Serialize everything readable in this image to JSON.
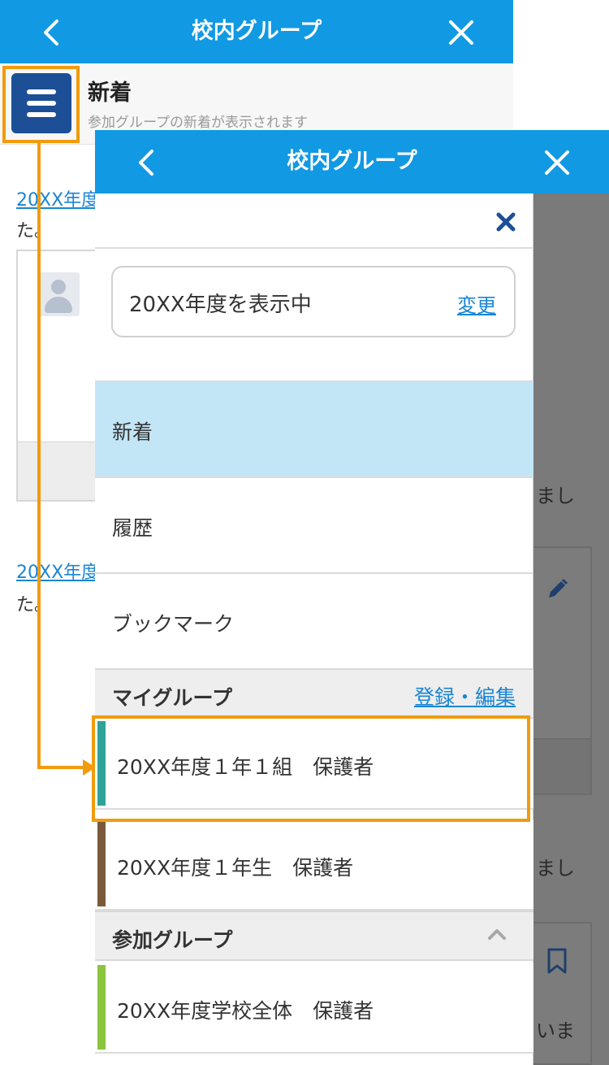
{
  "header": {
    "title": "校内グループ"
  },
  "subheader": {
    "title": "新着",
    "subtitle": "参加グループの新着が表示されます"
  },
  "background": {
    "link1": "20XX年度",
    "text1": "た。",
    "link2": "20XX年度",
    "text2": "た。",
    "side_text_1": "まし",
    "side_text_2": "まし",
    "side_text_3": "いま"
  },
  "drawer": {
    "title": "校内グループ",
    "year_label": "20XX年度を表示中",
    "change_label": "変更",
    "nav_items": [
      {
        "label": "新着",
        "active": true
      },
      {
        "label": "履歴",
        "active": false
      },
      {
        "label": "ブックマーク",
        "active": false
      }
    ],
    "my_groups": {
      "heading": "マイグループ",
      "edit_label": "登録・編集",
      "items": [
        {
          "label": "20XX年度１年１組　保護者",
          "color": "#2fa39a"
        },
        {
          "label": "20XX年度１年生　保護者",
          "color": "#7b5a3b"
        }
      ]
    },
    "joined_groups": {
      "heading": "参加グループ",
      "items": [
        {
          "label": "20XX年度学校全体　保護者",
          "color": "#8cc43c"
        }
      ]
    }
  },
  "colors": {
    "primary": "#1199e3",
    "menu_button": "#1c4f96",
    "highlight": "#f19b0e",
    "active_row": "#c3e6f6",
    "link": "#1a86d4"
  }
}
